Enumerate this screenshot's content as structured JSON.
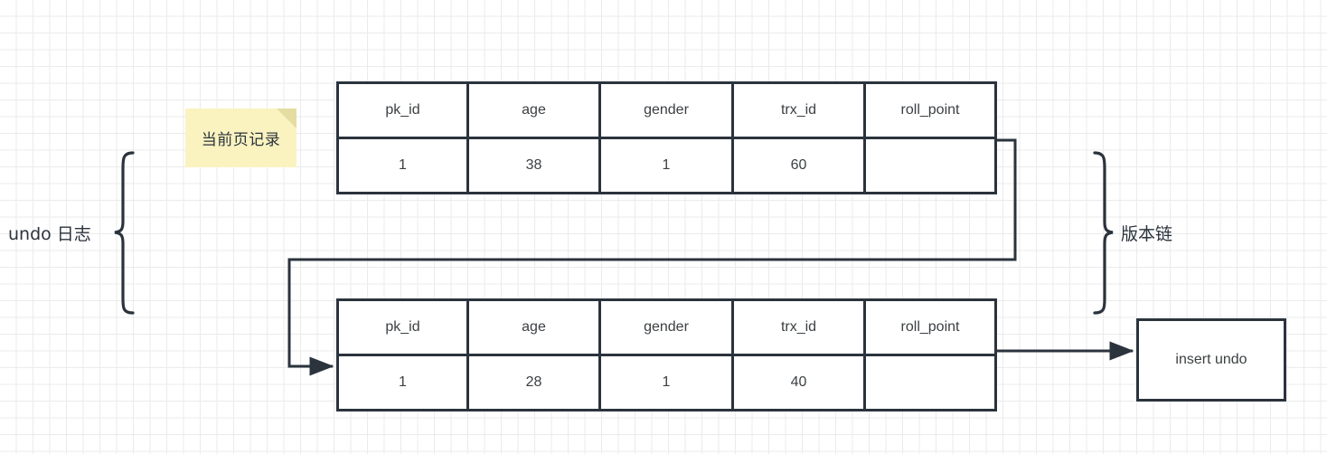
{
  "diagram": {
    "title_note": "当前页记录",
    "left_label": "undo 日志",
    "right_label": "版本链",
    "insert_undo_label": "insert undo",
    "colors": {
      "stroke": "#2b333d",
      "note_bg": "#faf3c0",
      "note_fold": "#e5dca2",
      "grid": "#ebebeb",
      "text": "#3c4043"
    }
  },
  "tables": [
    {
      "id": "current-page-record",
      "headers": [
        "pk_id",
        "age",
        "gender",
        "trx_id",
        "roll_point"
      ],
      "row": [
        "1",
        "38",
        "1",
        "60",
        ""
      ]
    },
    {
      "id": "undo-record",
      "headers": [
        "pk_id",
        "age",
        "gender",
        "trx_id",
        "roll_point"
      ],
      "row": [
        "1",
        "28",
        "1",
        "40",
        ""
      ]
    }
  ]
}
